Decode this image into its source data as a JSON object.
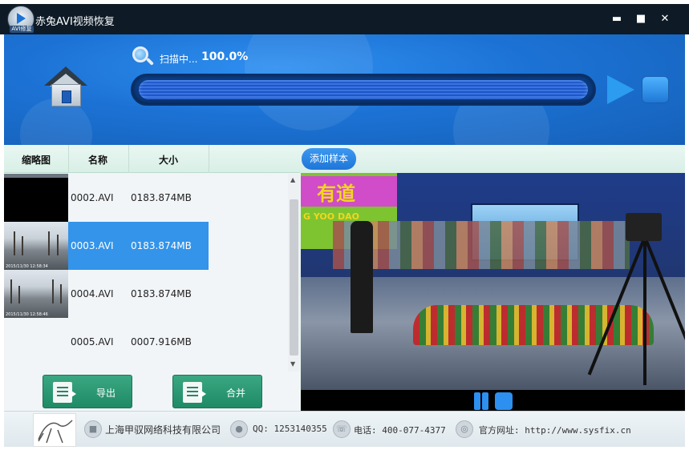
{
  "window": {
    "title": "赤兔AVI视频恢复",
    "logo_tag": "AVI修复",
    "min_icon": "minimize-icon",
    "max_icon": "maximize-icon",
    "close_icon": "close-icon"
  },
  "scan": {
    "status": "扫描中...",
    "percent_text": "100.0%",
    "progress": 1.0
  },
  "list": {
    "columns": [
      "缩略图",
      "名称",
      "大小"
    ],
    "rows": [
      {
        "name": "0002.AVI",
        "size": "0183.874MB",
        "thumb": "black",
        "selected": false
      },
      {
        "name": "0003.AVI",
        "size": "0183.874MB",
        "thumb": "road",
        "timestamp": "2015/11/30 12:58:34",
        "selected": true
      },
      {
        "name": "0004.AVI",
        "size": "0183.874MB",
        "thumb": "road",
        "timestamp": "2015/11/30 12:58:46",
        "selected": false
      },
      {
        "name": "0005.AVI",
        "size": "0007.916MB",
        "thumb": "none",
        "selected": false
      }
    ]
  },
  "actions": {
    "export_label": "导出",
    "merge_label": "合并"
  },
  "preview": {
    "add_sample_label": "添加样本",
    "banner_text": "有道",
    "banner_sub": "G YOO DAO"
  },
  "footer": {
    "company": "上海甲驭网络科技有限公司",
    "qq": "QQ: 1253140355",
    "phone": "电话: 400-077-4377",
    "website": "官方网址: http://www.sysfix.cn"
  },
  "colors": {
    "header_blue": "#1c72d4",
    "selected_row": "#3394ea",
    "action_green": "#1f8a66",
    "titlebar": "#0e1b27"
  }
}
